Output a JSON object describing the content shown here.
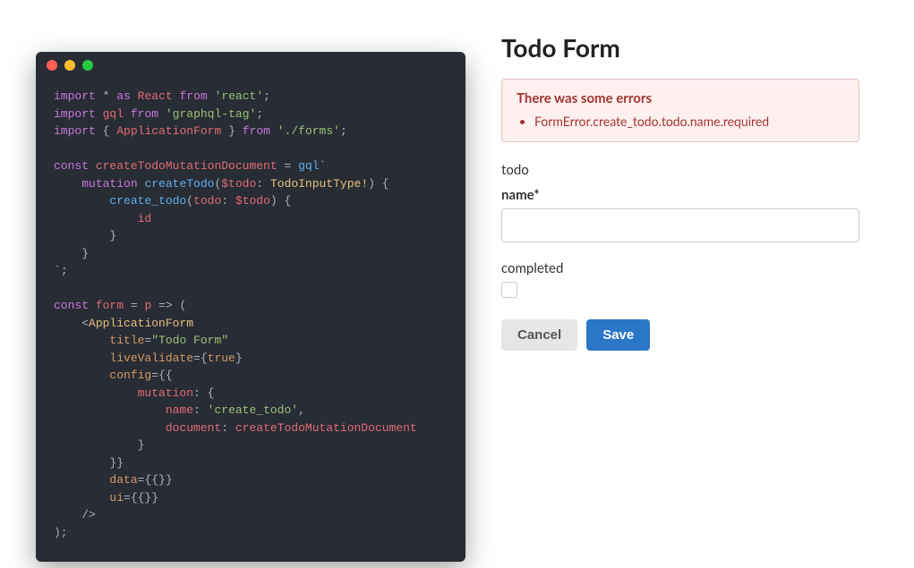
{
  "code": {
    "window_dots": [
      "red",
      "yellow",
      "green"
    ],
    "tokens": {
      "kw_import": "import",
      "kw_as": "as",
      "kw_from": "from",
      "kw_const": "const",
      "id_react": "React",
      "id_gql": "gql",
      "id_appform": "ApplicationForm",
      "id_form": "form",
      "id_p": "p",
      "id_mutation_name": "createTodoMutationDocument",
      "id_mutation_func": "createTodo",
      "id_create_todo": "create_todo",
      "id_todo_var": "$todo",
      "id_todo": "todo",
      "id_id": "id",
      "type_todoinput": "TodoInputType!",
      "mod_react": "'react'",
      "mod_gqltag": "'graphql-tag'",
      "mod_forms": "'./forms'",
      "str_title": "\"Todo Form\"",
      "str_createtodo": "'create_todo'",
      "attr_title": "title",
      "attr_livevalidate": "liveValidate",
      "attr_config": "config",
      "attr_data": "data",
      "attr_ui": "ui",
      "prop_mutation": "mutation",
      "prop_name": "name",
      "prop_document": "document",
      "bool_true": "true",
      "kw_mutation": "mutation"
    }
  },
  "form": {
    "title": "Todo Form",
    "error": {
      "title": "There was some errors",
      "items": [
        "FormError.create_todo.todo.name.required"
      ]
    },
    "group_legend": "todo",
    "name": {
      "label": "name*",
      "value": ""
    },
    "completed": {
      "label": "completed",
      "checked": false
    },
    "buttons": {
      "cancel": "Cancel",
      "save": "Save"
    }
  }
}
